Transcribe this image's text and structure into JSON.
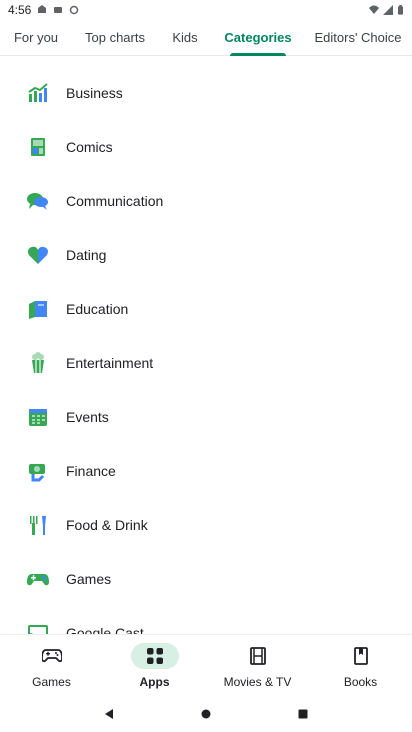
{
  "status_bar": {
    "time": "4:56"
  },
  "tabs": [
    {
      "label": "For you",
      "active": false
    },
    {
      "label": "Top charts",
      "active": false
    },
    {
      "label": "Kids",
      "active": false
    },
    {
      "label": "Categories",
      "active": true
    },
    {
      "label": "Editors' Choice",
      "active": false
    }
  ],
  "categories": [
    {
      "label": "Business",
      "icon": "business-icon"
    },
    {
      "label": "Comics",
      "icon": "comics-icon"
    },
    {
      "label": "Communication",
      "icon": "communication-icon"
    },
    {
      "label": "Dating",
      "icon": "dating-icon"
    },
    {
      "label": "Education",
      "icon": "education-icon"
    },
    {
      "label": "Entertainment",
      "icon": "entertainment-icon"
    },
    {
      "label": "Events",
      "icon": "events-icon"
    },
    {
      "label": "Finance",
      "icon": "finance-icon"
    },
    {
      "label": "Food & Drink",
      "icon": "food-drink-icon"
    },
    {
      "label": "Games",
      "icon": "games-icon"
    },
    {
      "label": "Google Cast",
      "icon": "google-cast-icon"
    }
  ],
  "bottom_nav": [
    {
      "label": "Games",
      "icon": "gamepad-icon",
      "active": false
    },
    {
      "label": "Apps",
      "icon": "apps-grid-icon",
      "active": true
    },
    {
      "label": "Movies & TV",
      "icon": "film-icon",
      "active": false
    },
    {
      "label": "Books",
      "icon": "book-icon",
      "active": false
    }
  ],
  "colors": {
    "accent": "#01875f",
    "icon_blue": "#4285f4",
    "icon_green": "#34a853",
    "active_pill": "#d7efe5"
  }
}
